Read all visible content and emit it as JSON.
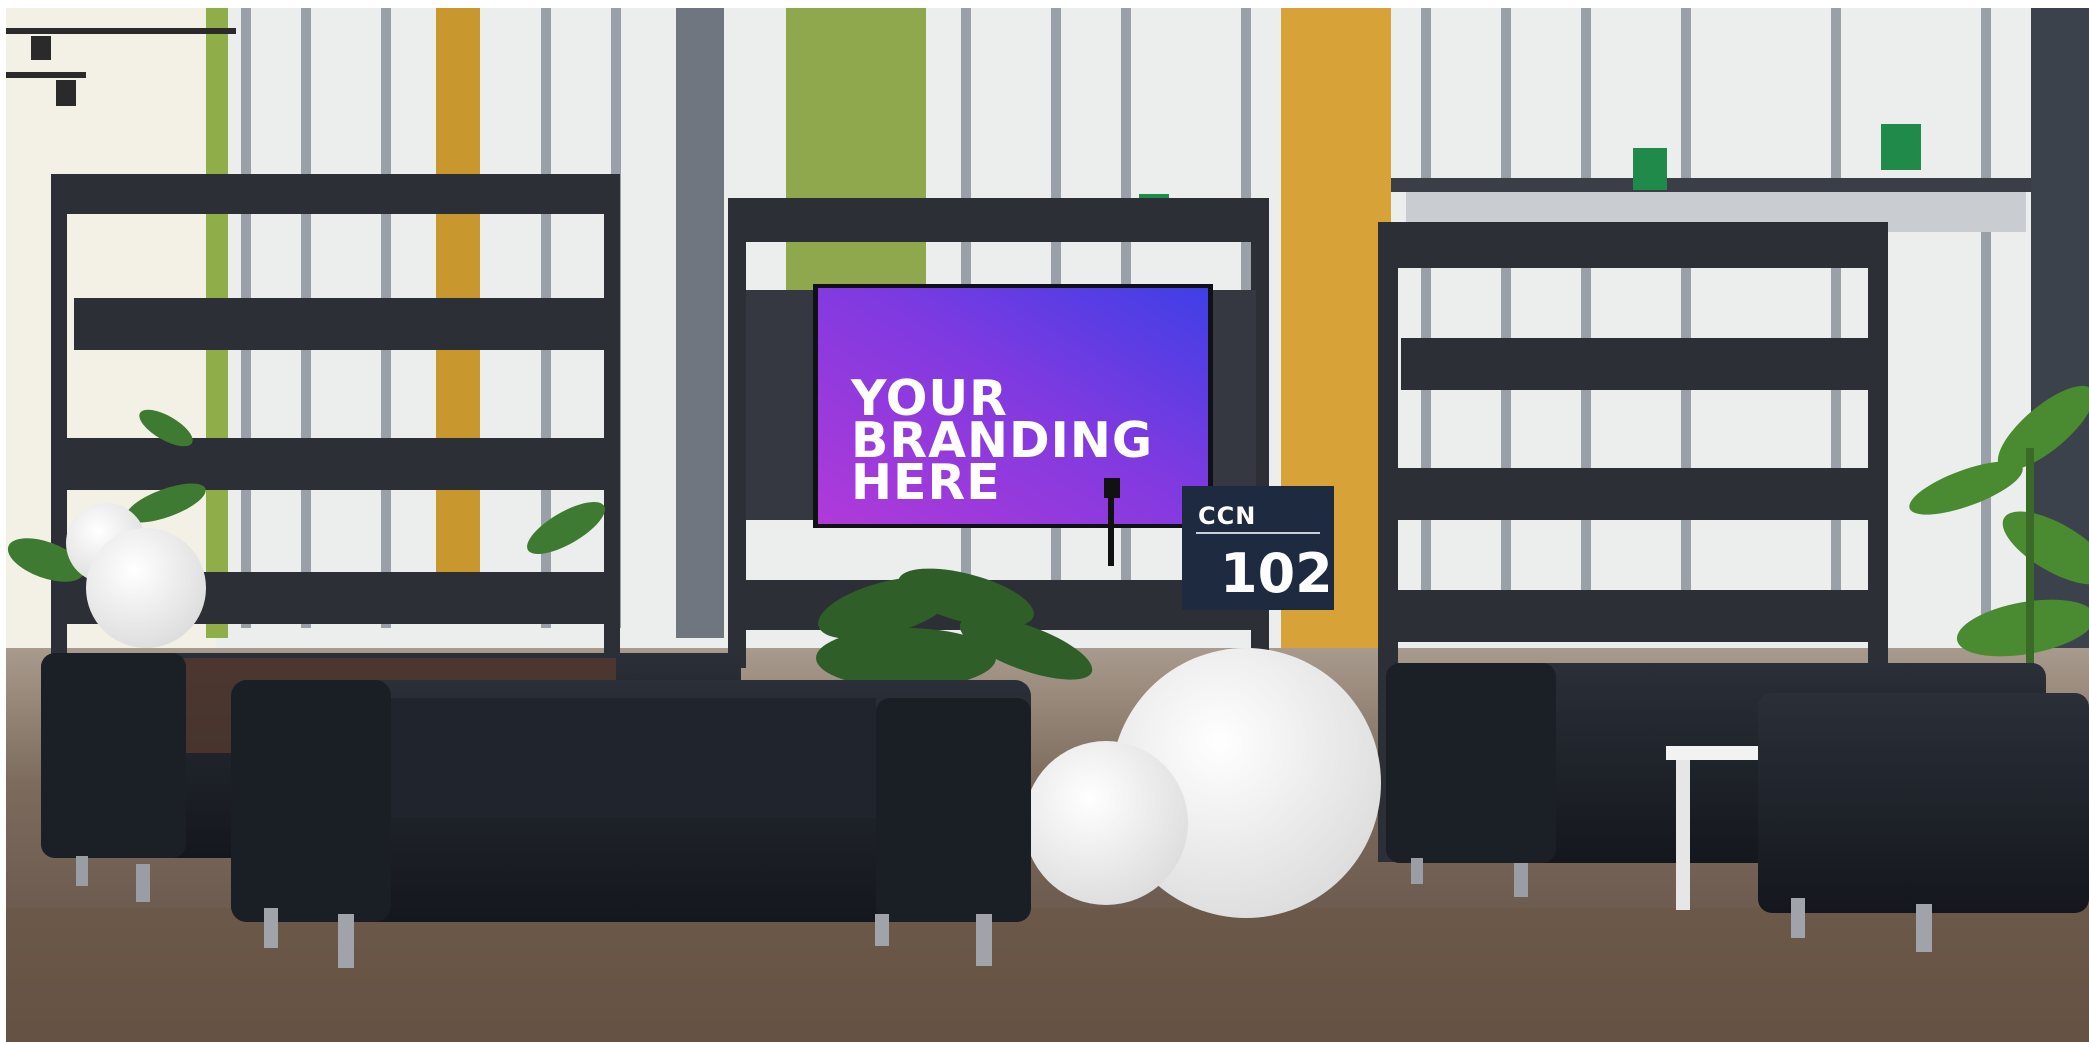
{
  "scene": {
    "description_icons": [
      "exit-sign-icon",
      "track-light-icon"
    ],
    "colors": {
      "floor": "#6e5a4a",
      "wall_yellow": "#d2a03c",
      "wall_green": "#96ac48",
      "sofa": "#1c2028",
      "frame": "#2c2f36",
      "screen_start": "#b03ad8",
      "screen_end": "#4a3ae0",
      "sign": "#1d2a40",
      "exit_sign": "#1f8a4a"
    }
  },
  "screen": {
    "lines": [
      "YOUR",
      "BRANDING",
      "HERE"
    ]
  },
  "sign": {
    "label": "CCN",
    "number": "102"
  }
}
